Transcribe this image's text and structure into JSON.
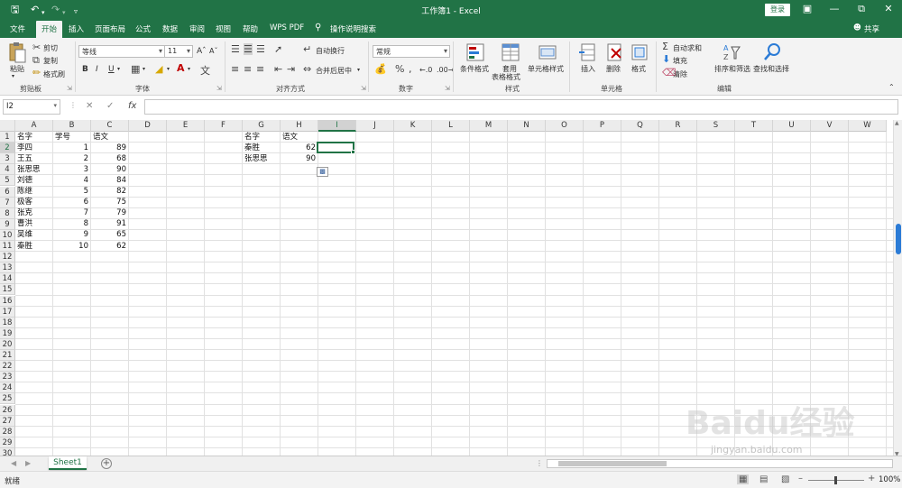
{
  "titlebar": {
    "doc_title": "工作簿1 - Excel",
    "login_label": "登录"
  },
  "tabs": {
    "items": [
      "文件",
      "开始",
      "插入",
      "页面布局",
      "公式",
      "数据",
      "审阅",
      "视图",
      "帮助",
      "WPS PDF"
    ],
    "active": "开始",
    "tell_me": "操作说明搜索",
    "share": "共享"
  },
  "ribbon": {
    "clipboard": {
      "paste": "粘贴",
      "cut": "剪切",
      "copy": "复制",
      "format_painter": "格式刷",
      "label": "剪贴板"
    },
    "font": {
      "name": "等线",
      "size": "11",
      "label": "字体",
      "bold": "B",
      "italic": "I",
      "underline": "U"
    },
    "alignment": {
      "wrap": "自动换行",
      "merge": "合并后居中",
      "label": "对齐方式"
    },
    "number": {
      "format": "常规",
      "label": "数字"
    },
    "styles": {
      "conditional": "条件格式",
      "table_line1": "套用",
      "table_line2": "表格格式",
      "cell_styles": "单元格样式",
      "label": "样式"
    },
    "cells": {
      "insert": "插入",
      "delete": "删除",
      "format": "格式",
      "label": "单元格"
    },
    "editing": {
      "autosum": "自动求和",
      "fill": "填充",
      "clear": "清除",
      "sort": "排序和筛选",
      "find": "查找和选择",
      "label": "编辑"
    }
  },
  "formula_bar": {
    "name_box": "I2",
    "fx": "fx",
    "value": ""
  },
  "sheet": {
    "columns": [
      "A",
      "B",
      "C",
      "D",
      "E",
      "F",
      "G",
      "H",
      "I",
      "J",
      "K",
      "L",
      "M",
      "N",
      "O",
      "P",
      "Q",
      "R",
      "S",
      "T",
      "U",
      "V",
      "W"
    ],
    "selected_column": "I",
    "row_count": 30,
    "selected_row": 2,
    "cells": [
      {
        "col": "A",
        "row": 1,
        "value": "名字"
      },
      {
        "col": "B",
        "row": 1,
        "value": "学号"
      },
      {
        "col": "C",
        "row": 1,
        "value": "语文"
      },
      {
        "col": "A",
        "row": 2,
        "value": "李四"
      },
      {
        "col": "B",
        "row": 2,
        "value": "1",
        "num": true
      },
      {
        "col": "C",
        "row": 2,
        "value": "89",
        "num": true
      },
      {
        "col": "A",
        "row": 3,
        "value": "王五"
      },
      {
        "col": "B",
        "row": 3,
        "value": "2",
        "num": true
      },
      {
        "col": "C",
        "row": 3,
        "value": "68",
        "num": true
      },
      {
        "col": "A",
        "row": 4,
        "value": "张思思"
      },
      {
        "col": "B",
        "row": 4,
        "value": "3",
        "num": true
      },
      {
        "col": "C",
        "row": 4,
        "value": "90",
        "num": true
      },
      {
        "col": "A",
        "row": 5,
        "value": "刘德"
      },
      {
        "col": "B",
        "row": 5,
        "value": "4",
        "num": true
      },
      {
        "col": "C",
        "row": 5,
        "value": "84",
        "num": true
      },
      {
        "col": "A",
        "row": 6,
        "value": "陈继"
      },
      {
        "col": "B",
        "row": 6,
        "value": "5",
        "num": true
      },
      {
        "col": "C",
        "row": 6,
        "value": "82",
        "num": true
      },
      {
        "col": "A",
        "row": 7,
        "value": "极客"
      },
      {
        "col": "B",
        "row": 7,
        "value": "6",
        "num": true
      },
      {
        "col": "C",
        "row": 7,
        "value": "75",
        "num": true
      },
      {
        "col": "A",
        "row": 8,
        "value": "张克"
      },
      {
        "col": "B",
        "row": 8,
        "value": "7",
        "num": true
      },
      {
        "col": "C",
        "row": 8,
        "value": "79",
        "num": true
      },
      {
        "col": "A",
        "row": 9,
        "value": "曹洪"
      },
      {
        "col": "B",
        "row": 9,
        "value": "8",
        "num": true
      },
      {
        "col": "C",
        "row": 9,
        "value": "91",
        "num": true
      },
      {
        "col": "A",
        "row": 10,
        "value": "吴维"
      },
      {
        "col": "B",
        "row": 10,
        "value": "9",
        "num": true
      },
      {
        "col": "C",
        "row": 10,
        "value": "65",
        "num": true
      },
      {
        "col": "A",
        "row": 11,
        "value": "秦胜"
      },
      {
        "col": "B",
        "row": 11,
        "value": "10",
        "num": true
      },
      {
        "col": "C",
        "row": 11,
        "value": "62",
        "num": true
      },
      {
        "col": "G",
        "row": 1,
        "value": "名字"
      },
      {
        "col": "H",
        "row": 1,
        "value": "语文"
      },
      {
        "col": "G",
        "row": 2,
        "value": "秦胜"
      },
      {
        "col": "H",
        "row": 2,
        "value": "62",
        "num": true
      },
      {
        "col": "G",
        "row": 3,
        "value": "张思思"
      },
      {
        "col": "H",
        "row": 3,
        "value": "90",
        "num": true
      }
    ]
  },
  "sheet_tabs": {
    "active": "Sheet1"
  },
  "statusbar": {
    "status": "就绪",
    "zoom": "100%"
  },
  "watermark": {
    "brand": "Baidu经验",
    "url": "jingyan.baidu.com"
  },
  "colors": {
    "excel_green": "#217346",
    "selection": "#217346"
  }
}
